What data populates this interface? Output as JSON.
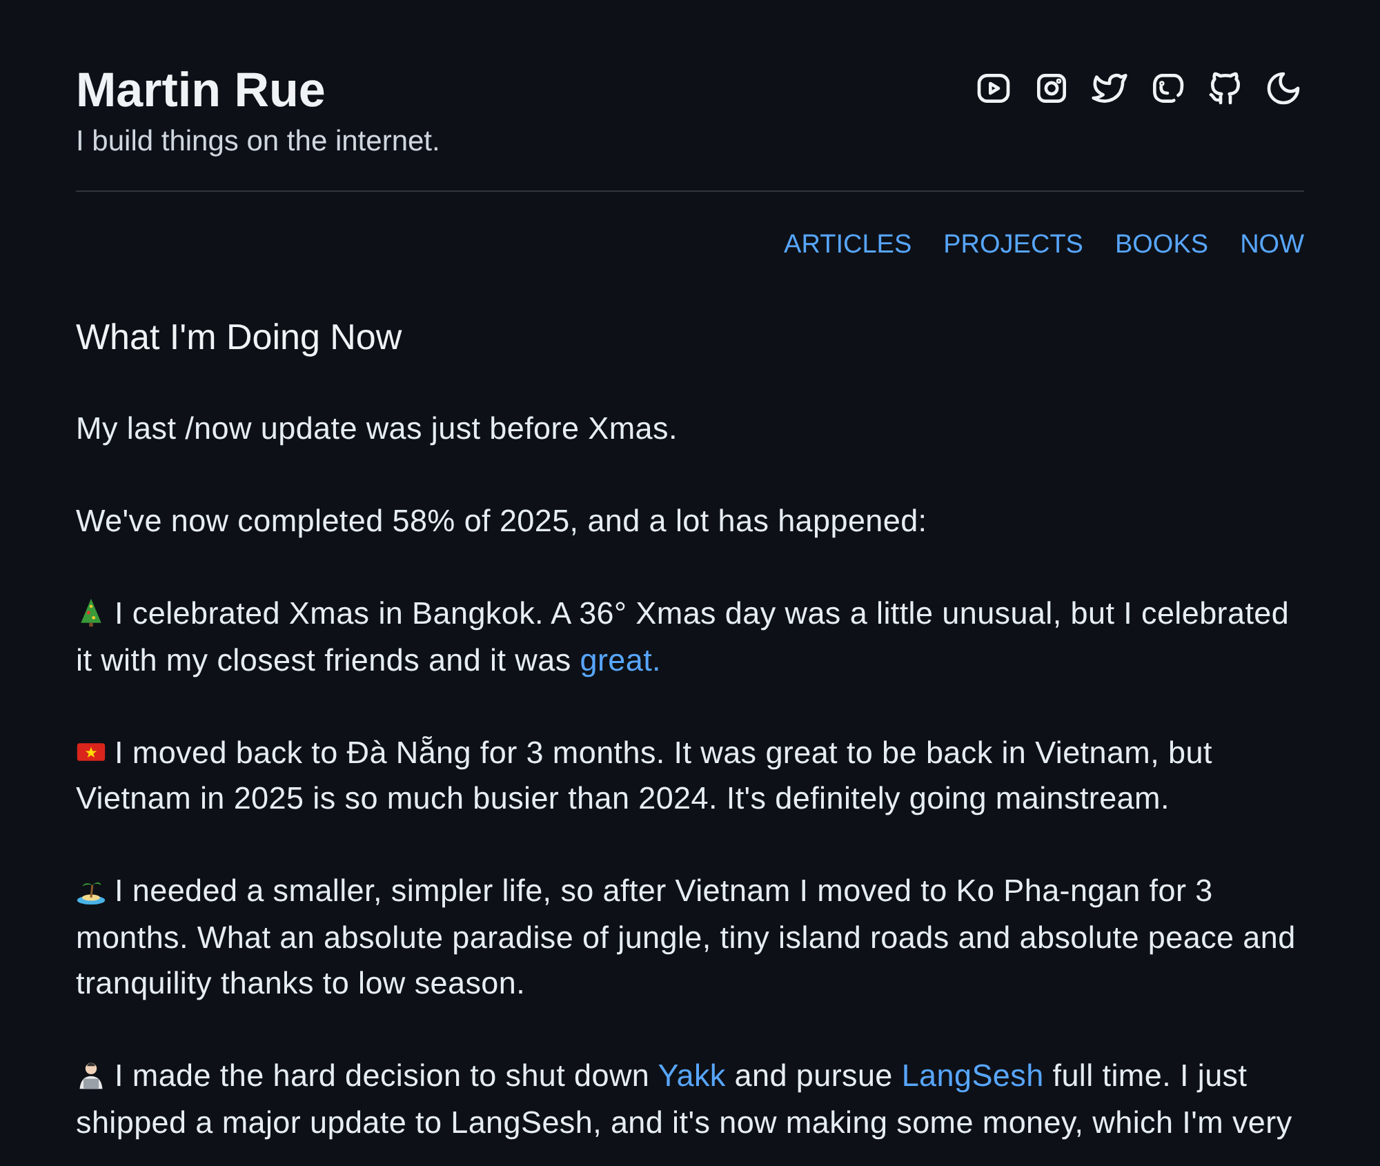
{
  "header": {
    "title": "Martin Rue",
    "tagline": "I build things on the internet."
  },
  "nav": [
    {
      "label": "ARTICLES"
    },
    {
      "label": "PROJECTS"
    },
    {
      "label": "BOOKS"
    },
    {
      "label": "NOW"
    }
  ],
  "heading": "What I'm Doing Now",
  "paragraphs": [
    {
      "segments": [
        {
          "kind": "text",
          "text": "My last /now update was just before Xmas."
        }
      ]
    },
    {
      "segments": [
        {
          "kind": "text",
          "text": "We've now completed 58% of 2025, and a lot has happened:"
        }
      ]
    },
    {
      "kind": "tree",
      "segments": [
        {
          "kind": "text",
          "text": "I celebrated Xmas in Bangkok. A 36° Xmas day was a little unusual, but I celebrated it with my closest friends and it was "
        },
        {
          "kind": "link",
          "text": "great."
        }
      ]
    },
    {
      "kind": "flag",
      "segments": [
        {
          "kind": "text",
          "text": "I moved back to Đà Nẵng for 3 months. It was great to be back in Vietnam, but Vietnam in 2025 is so much busier than 2024. It's definitely going mainstream."
        }
      ]
    },
    {
      "kind": "island",
      "segments": [
        {
          "kind": "text",
          "text": "I needed a smaller, simpler life, so after Vietnam I moved to Ko Pha-ngan for 3 months. What an absolute paradise of jungle, tiny island roads and absolute peace and tranquility thanks to low season."
        }
      ]
    },
    {
      "kind": "laptop",
      "segments": [
        {
          "kind": "text",
          "text": "I made the hard decision to shut down "
        },
        {
          "kind": "link",
          "text": "Yakk"
        },
        {
          "kind": "text",
          "text": " and pursue "
        },
        {
          "kind": "link",
          "text": "LangSesh"
        },
        {
          "kind": "text",
          "text": " full time. I just shipped a major update to LangSesh, and it's now making some money, which I'm very"
        }
      ]
    }
  ]
}
